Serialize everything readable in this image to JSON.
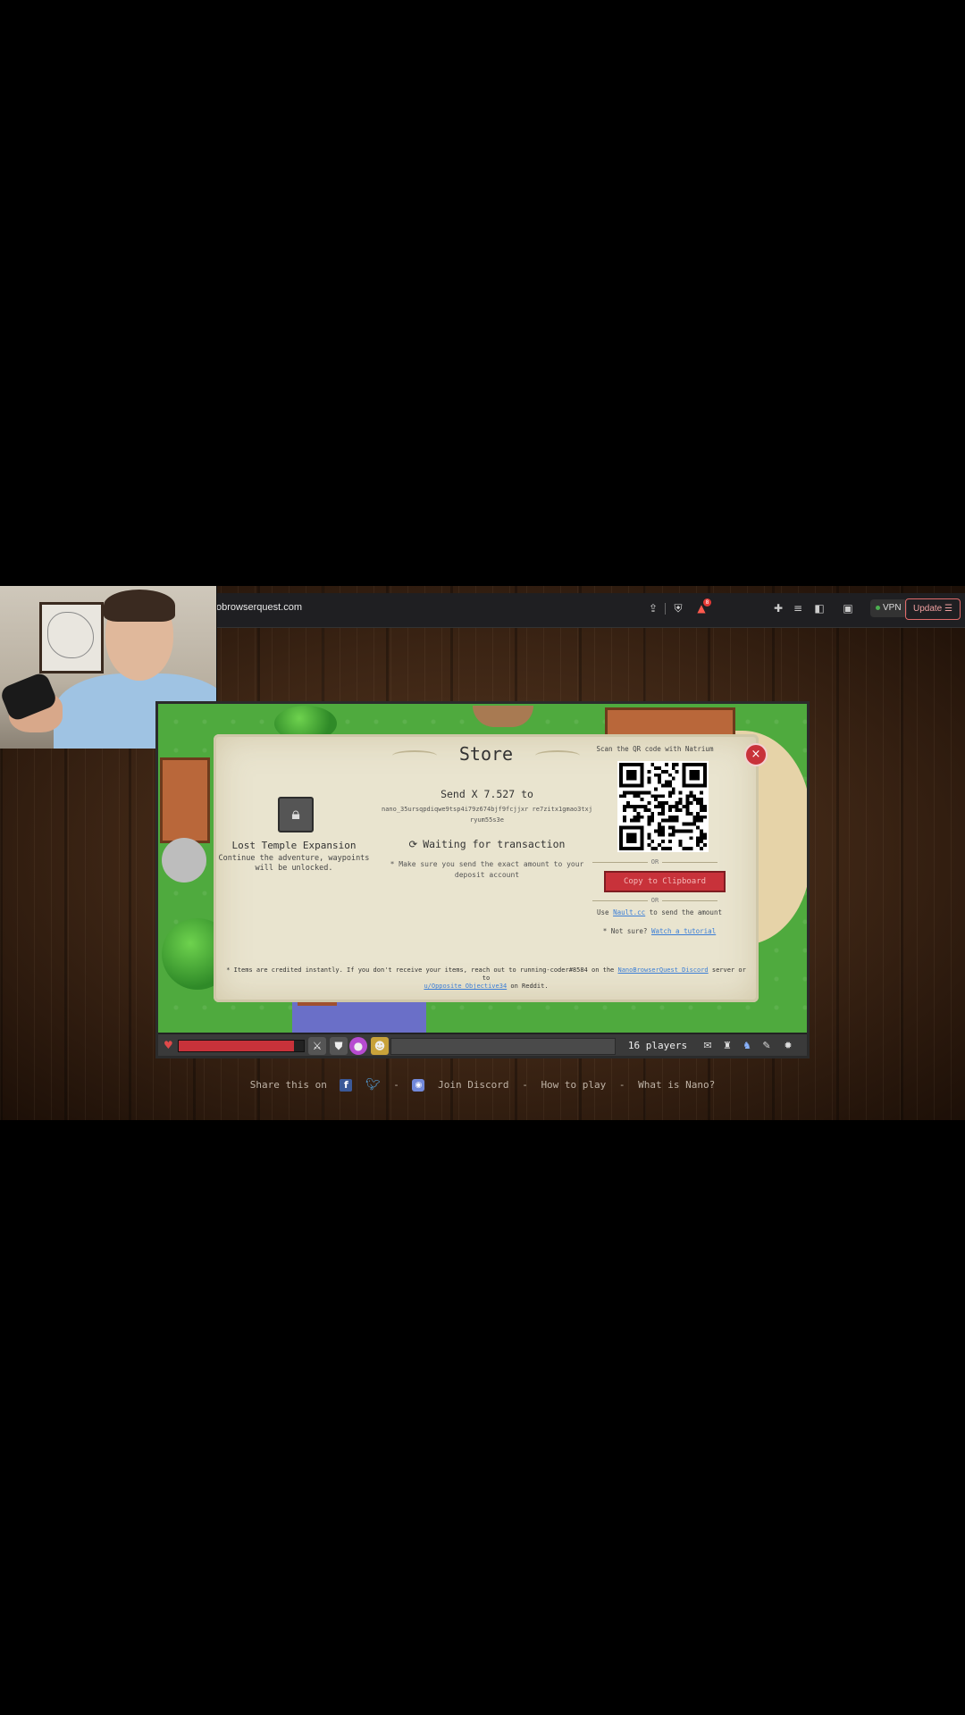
{
  "browser": {
    "url": "obrowserquest.com",
    "vpn_label": "VPN",
    "update_label": "Update",
    "icons": [
      "share-icon",
      "brave-shield-icon",
      "brave-rewards-icon",
      "extensions-icon",
      "playlist-icon",
      "sidebar-icon",
      "wallet-icon",
      "menu-icon"
    ],
    "notification_count": "8"
  },
  "store": {
    "title": "Store",
    "close_symbol": "×",
    "product": {
      "name": "Lost Temple Expansion",
      "description": "Continue the adventure, waypoints will be unlocked."
    },
    "send_amount": "Send X 7.527 to",
    "address": "nano_35ursqpdiqwe9tsp4i79z674bjf9fcjjxr re7zitx1gmao3txjryum55s3e",
    "waiting": "Waiting for transaction",
    "note": "* Make sure you send the exact amount to your deposit account",
    "qr_label": "Scan the QR code with Natrium",
    "or_1": "OR",
    "copy_button": "Copy to Clipboard",
    "or_2": "OR",
    "nault_prefix": "Use",
    "nault_link": "Nault.cc",
    "nault_suffix": "to send the amount",
    "tutorial_prefix": "* Not sure?",
    "tutorial_link": "Watch a tutorial",
    "footer_note_1": "* Items are credited instantly. If you don't receive your items, reach out to running-coder#8584 on the",
    "footer_discord_link": "NanoBrowserQuest Discord",
    "footer_note_2": "server or to",
    "footer_reddit_link": "u/Opposite_Objective34",
    "footer_note_3": "on Reddit."
  },
  "hud": {
    "health_fraction": 0.92,
    "players": "16 players"
  },
  "share": {
    "prefix": "Share this on",
    "sep": "-",
    "discord": "Join Discord",
    "how_to_play": "How to play",
    "what_is_nano": "What is Nano?"
  },
  "colors": {
    "accent_red": "#c8323a",
    "parchment": "#e9e4cf",
    "link_blue": "#3b7ed6"
  }
}
